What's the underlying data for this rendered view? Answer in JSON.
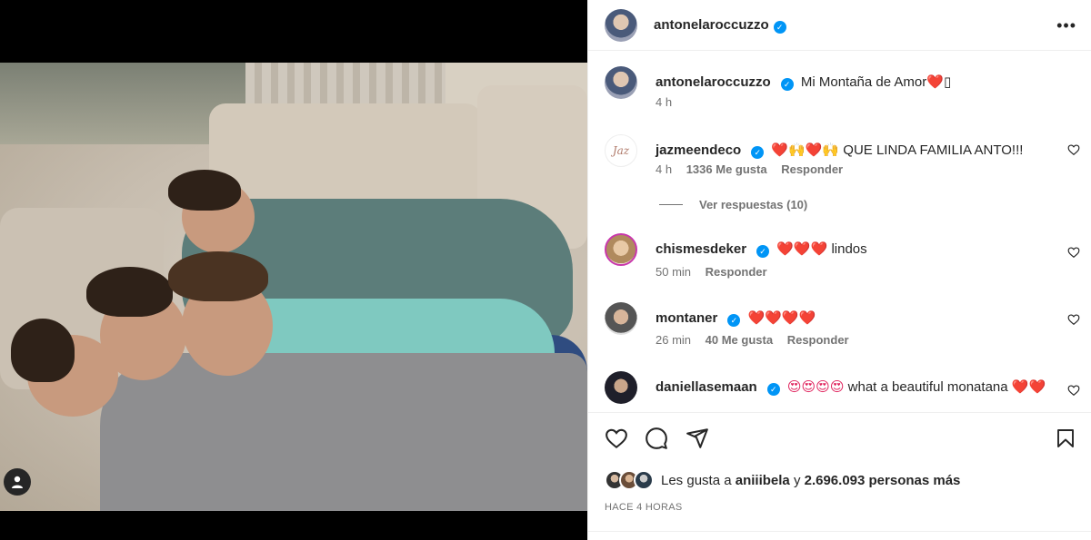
{
  "post": {
    "author": "antonelaroccuzzo"
  },
  "caption": {
    "username": "antonelaroccuzzo",
    "text": "Mi Montaña de Amor",
    "emoji": "❤️",
    "emoji_extra": "▯",
    "time": "4 h"
  },
  "comments": [
    {
      "username": "jazmeendeco",
      "emojis": "❤️🙌❤️🙌",
      "text": "QUE LINDA FAMILIA ANTO!!!",
      "time": "4 h",
      "likes": "1336 Me gusta",
      "reply": "Responder"
    },
    {
      "username": "chismesdeker",
      "emojis": "❤️❤️❤️",
      "text": "lindos",
      "time": "50 min",
      "reply": "Responder"
    },
    {
      "username": "montaner",
      "emojis": "❤️❤️❤️❤️",
      "text": "",
      "time": "26 min",
      "likes": "40 Me gusta",
      "reply": "Responder"
    },
    {
      "username": "daniellasemaan",
      "emojis": "😍😍😍😍",
      "text": "what a beautiful monatana",
      "tail": "❤️❤️"
    }
  ],
  "replies_link": "Ver respuestas (10)",
  "likes_summary": {
    "prefix": "Les gusta a",
    "user": "aniiibela",
    "connector": "y",
    "others": "2.696.093 personas más"
  },
  "timestamp": "HACE 4 HORAS",
  "colors": {
    "verified": "#0095f6",
    "muted": "#737373",
    "heart": "#e0245e"
  }
}
